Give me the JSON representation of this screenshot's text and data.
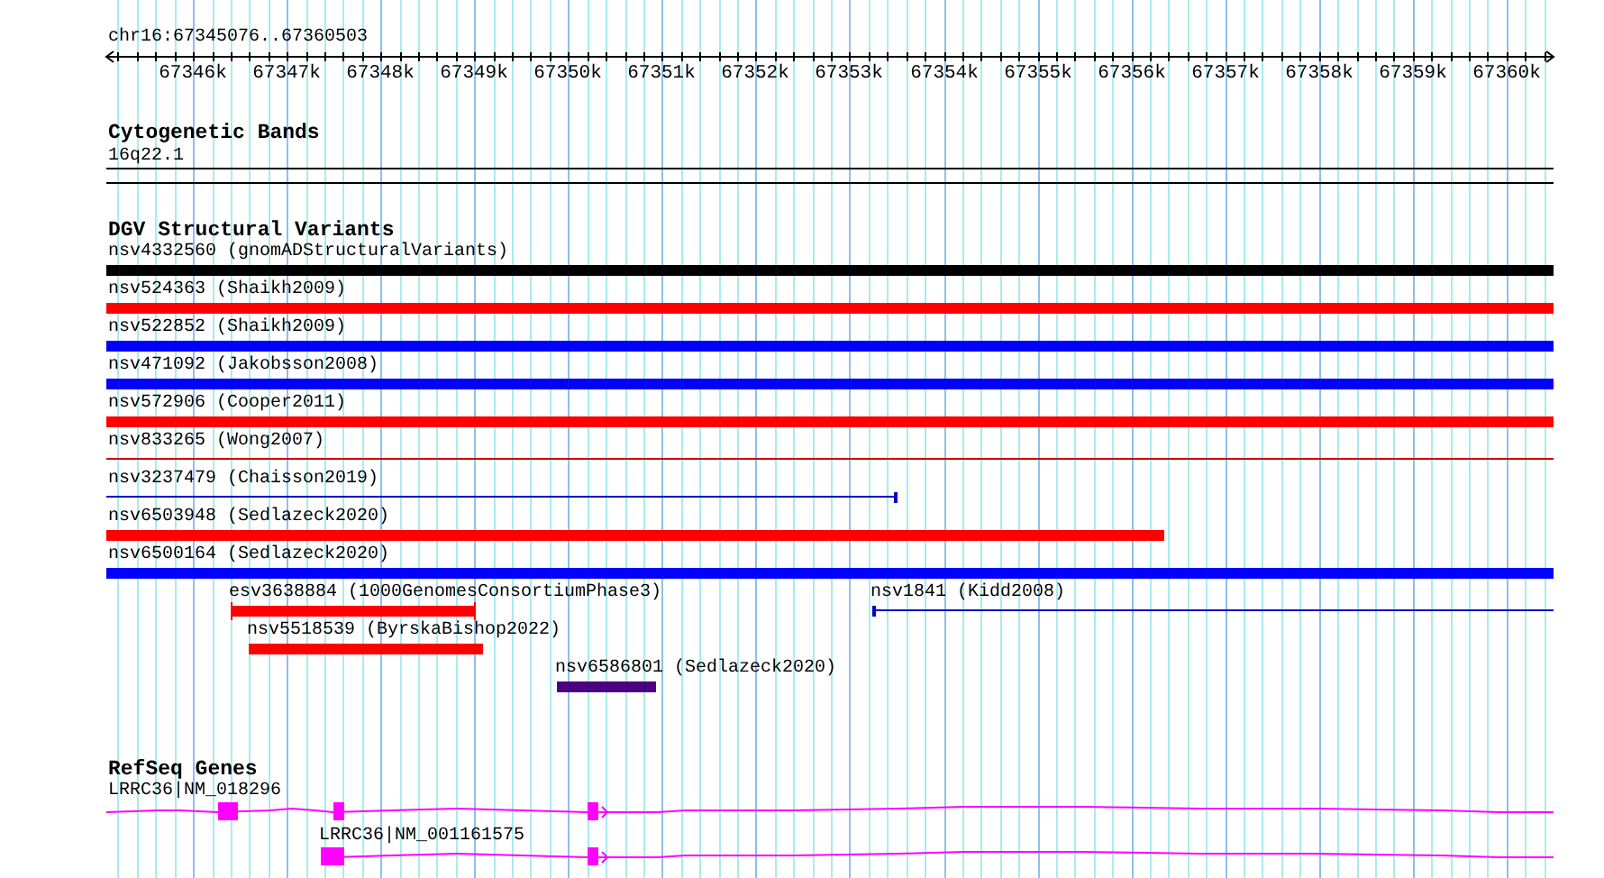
{
  "location": "chr16:67345076..67360503",
  "ruler": {
    "ticks": [
      "67346k",
      "67347k",
      "67348k",
      "67349k",
      "67350k",
      "67351k",
      "67352k",
      "67353k",
      "67354k",
      "67355k",
      "67356k",
      "67357k",
      "67358k",
      "67359k",
      "67360k"
    ]
  },
  "cytogenetic_bands": {
    "title": "Cytogenetic Bands",
    "features": [
      {
        "label": "16q22.1"
      }
    ]
  },
  "dgv_variants": {
    "title": "DGV Structural Variants",
    "features": [
      {
        "label": "nsv4332560 (gnomADStructuralVariants)",
        "kind": "bar",
        "color": "#000000"
      },
      {
        "label": "nsv524363 (Shaikh2009)",
        "kind": "bar",
        "color": "#ff0000"
      },
      {
        "label": "nsv522852 (Shaikh2009)",
        "kind": "bar",
        "color": "#0000ff"
      },
      {
        "label": "nsv471092 (Jakobsson2008)",
        "kind": "bar",
        "color": "#0000ff"
      },
      {
        "label": "nsv572906 (Cooper2011)",
        "kind": "bar",
        "color": "#ff0000"
      },
      {
        "label": "nsv833265 (Wong2007)",
        "kind": "line",
        "color": "#cc0000"
      },
      {
        "label": "nsv3237479 (Chaisson2019)",
        "kind": "line",
        "color": "#0000cc"
      },
      {
        "label": "nsv6503948 (Sedlazeck2020)",
        "kind": "bar",
        "color": "#ff0000"
      },
      {
        "label": "nsv6500164 (Sedlazeck2020)",
        "kind": "bar",
        "color": "#0000ff"
      },
      {
        "label": "esv3638884 (1000GenomesConsortiumPhase3)",
        "kind": "bar",
        "color": "#ff0000"
      },
      {
        "label": "nsv1841 (Kidd2008)",
        "kind": "line",
        "color": "#0000cc"
      },
      {
        "label": "nsv5518539 (ByrskaBishop2022)",
        "kind": "bar",
        "color": "#ff0000"
      },
      {
        "label": "nsv6586801 (Sedlazeck2020)",
        "kind": "bar",
        "color": "#4b0082"
      }
    ]
  },
  "refseq_genes": {
    "title": "RefSeq Genes",
    "features": [
      {
        "label": "LRRC36|NM_018296"
      },
      {
        "label": "LRRC36|NM_001161575"
      }
    ]
  }
}
